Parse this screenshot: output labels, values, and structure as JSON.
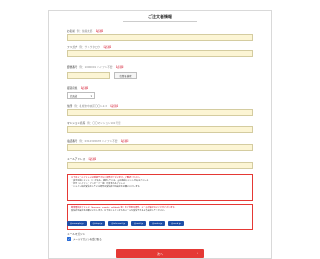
{
  "page": {
    "title": "ご注文者情報"
  },
  "form": {
    "name": {
      "label": "お名前",
      "note": "例：佐藤太郎",
      "required": "【必須】"
    },
    "kana": {
      "label": "フリガナ",
      "note": "例：サトウタロウ",
      "required": "【必須】"
    },
    "zip": {
      "label": "郵便番号",
      "note": "例：1000001 ハイフン不要",
      "required": "【必須】",
      "button": "住所を検索"
    },
    "pref": {
      "label": "都道府県",
      "required": "【必須】",
      "value": "北海道"
    },
    "address": {
      "label": "住所",
      "note": "例：札幌市中央区〇〇1-2-3",
      "required": "【必須】"
    },
    "building": {
      "label": "マンション名等",
      "note": "例：〇〇マンション101号室"
    },
    "tel": {
      "label": "電話番号",
      "note": "例：0312345678 ハイフン不要",
      "required": "【必須】"
    },
    "email": {
      "label": "メールアドレス",
      "required": "【必須】"
    }
  },
  "notice1": {
    "lines": [
      "以下のメールアドレスは登録できない場合がございます。ご確認ください。",
      "・英字の前にドット（.）がある、連続している、@の直前にドットがあるアドレス",
      "・記号（ハイフン・アンダーバー等）が含まれるアドレス",
      "・ドメイン指定受信をしている場合は受信許可の設定をお願いいたします。"
    ]
  },
  "notice2": {
    "lines": [
      "携帯電話のアドレス（docomo、ezweb、softbank 等）をご利用の場合、メールが届かないことがございます。",
      "受信許可設定をお願いいたします。以下のドメインからのメールを受信できるよう設定してください。"
    ]
  },
  "domains": [
    "@example.jp",
    "@shop.jp",
    "@info-mail.jp",
    "@mail.jp",
    "@order.jp",
    "@send.jp"
  ],
  "newsletter": {
    "label": "メールマガジン",
    "checkbox": "メールマガジンを受け取る"
  },
  "next_button": {
    "label": "次へ",
    "arrow": "›"
  },
  "colors": {
    "accent": "#e53935",
    "input_bg": "#fcf5d4",
    "chip": "#1e4fa8",
    "check": "#2b6cd6"
  }
}
